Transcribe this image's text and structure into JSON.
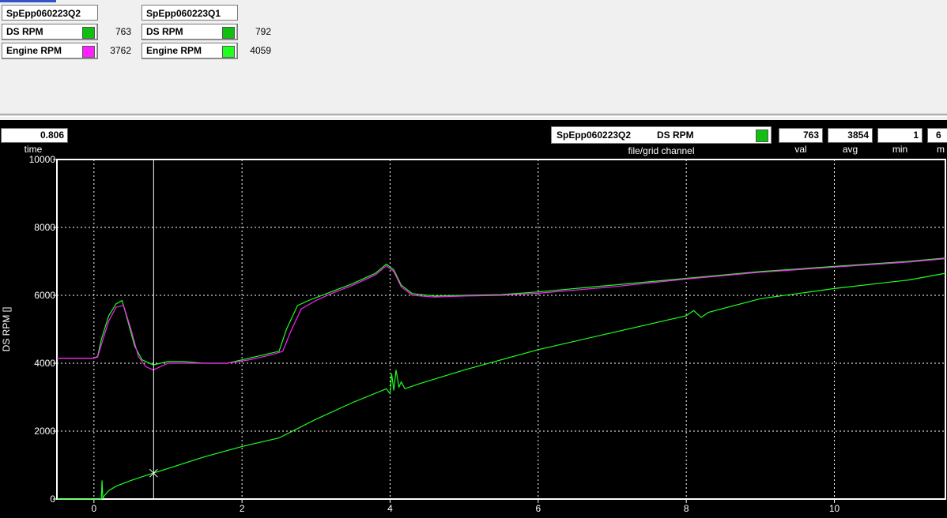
{
  "legend": {
    "groups": [
      {
        "file": "SpEpp060223Q2",
        "channels": [
          {
            "name": "DS RPM",
            "value": "763",
            "color": "#10c010"
          },
          {
            "name": "Engine RPM",
            "value": "3762",
            "color": "#ff20ff"
          }
        ]
      },
      {
        "file": "SpEpp060223Q1",
        "channels": [
          {
            "name": "DS RPM",
            "value": "792",
            "color": "#10c010"
          },
          {
            "name": "Engine RPM",
            "value": "4059",
            "color": "#20ff20"
          }
        ]
      }
    ]
  },
  "cursor_bar": {
    "time_value": "0.806",
    "time_label": "time",
    "file": "SpEpp060223Q2",
    "channel": "DS RPM",
    "channel_color": "#10c010",
    "file_grid_label": "file/grid channel",
    "val": "763",
    "val_label": "val",
    "avg": "3854",
    "avg_label": "avg",
    "min": "1",
    "min_label": "min",
    "max_partial": "6",
    "max_label_partial": "m"
  },
  "chart_data": {
    "type": "line",
    "ylabel": "DS RPM []",
    "xlabel": "",
    "xlim": [
      -0.5,
      11.5
    ],
    "ylim": [
      0,
      10000
    ],
    "x_ticks": [
      0,
      2,
      4,
      6,
      8,
      10
    ],
    "y_ticks": [
      0,
      2000,
      4000,
      6000,
      8000,
      10000
    ],
    "grid": true,
    "cursor_x": 0.806,
    "series": [
      {
        "color": "#20ff20",
        "x": [
          -0.5,
          0.0,
          0.05,
          0.1,
          0.2,
          0.3,
          0.38,
          0.45,
          0.55,
          0.65,
          0.8,
          1.0,
          1.2,
          1.5,
          1.8,
          2.1,
          2.4,
          2.5,
          2.6,
          2.75,
          2.9,
          3.2,
          3.5,
          3.8,
          3.95,
          4.05,
          4.15,
          4.3,
          4.6,
          5.0,
          5.5,
          6.0,
          7.0,
          8.0,
          9.0,
          10.0,
          11.0,
          11.5
        ],
        "y": [
          4150,
          4150,
          4200,
          4700,
          5400,
          5750,
          5850,
          5300,
          4500,
          4100,
          3950,
          4050,
          4050,
          4000,
          4000,
          4150,
          4300,
          4350,
          5000,
          5700,
          5850,
          6100,
          6350,
          6650,
          6920,
          6750,
          6300,
          6050,
          5980,
          6000,
          6020,
          6100,
          6300,
          6500,
          6700,
          6850,
          7000,
          7100
        ]
      },
      {
        "color": "#ff20ff",
        "x": [
          -0.5,
          0.0,
          0.05,
          0.1,
          0.2,
          0.3,
          0.4,
          0.5,
          0.6,
          0.7,
          0.8,
          1.0,
          1.2,
          1.5,
          1.8,
          2.1,
          2.4,
          2.55,
          2.65,
          2.8,
          3.0,
          3.2,
          3.5,
          3.8,
          3.95,
          4.05,
          4.15,
          4.3,
          4.6,
          5.0,
          5.5,
          6.0,
          7.0,
          8.0,
          9.0,
          10.0,
          11.0,
          11.5
        ],
        "y": [
          4150,
          4150,
          4180,
          4550,
          5250,
          5650,
          5700,
          5000,
          4200,
          3900,
          3800,
          4000,
          4000,
          4000,
          4000,
          4100,
          4250,
          4350,
          4900,
          5600,
          5850,
          6050,
          6300,
          6600,
          6870,
          6700,
          6250,
          6000,
          5950,
          5980,
          6000,
          6060,
          6250,
          6480,
          6680,
          6830,
          6980,
          7080
        ]
      },
      {
        "color": "#20ff20",
        "x": [
          -0.5,
          0.1,
          0.11,
          0.12,
          0.13,
          0.14,
          0.2,
          0.3,
          0.5,
          0.8,
          1.0,
          1.5,
          2.0,
          2.5,
          3.0,
          3.5,
          3.95,
          4.0,
          4.02,
          4.05,
          4.08,
          4.12,
          4.15,
          4.2,
          4.4,
          5.0,
          6.0,
          7.0,
          8.0,
          8.1,
          8.2,
          8.3,
          9.0,
          10.0,
          11.0,
          11.5
        ],
        "y": [
          0,
          0,
          550,
          10,
          60,
          100,
          250,
          380,
          550,
          763,
          900,
          1250,
          1550,
          1800,
          2350,
          2850,
          3250,
          3100,
          3700,
          3200,
          3800,
          3300,
          3450,
          3250,
          3400,
          3800,
          4400,
          4900,
          5400,
          5550,
          5350,
          5500,
          5900,
          6200,
          6450,
          6650
        ]
      }
    ]
  }
}
